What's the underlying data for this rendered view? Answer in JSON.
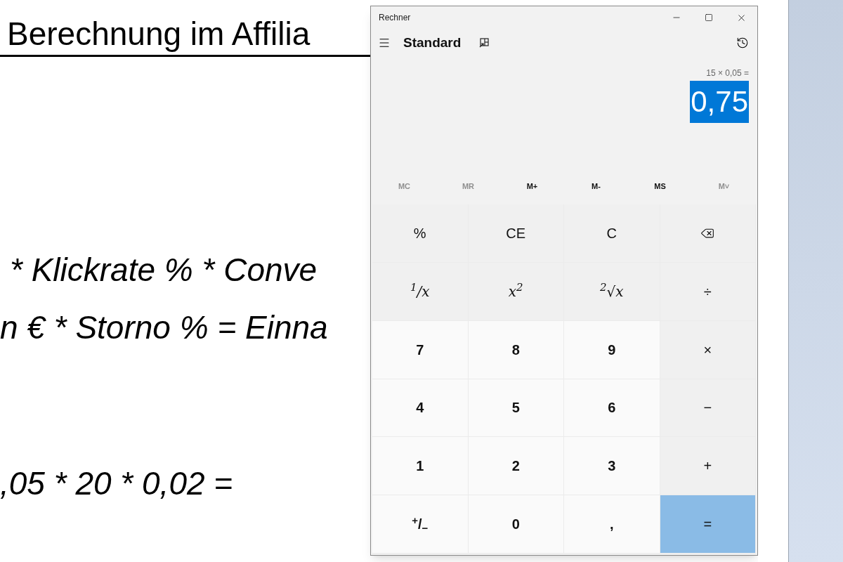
{
  "document": {
    "heading": "Berechnung im Affilia",
    "lines": [
      "* Klickrate % * Conve",
      "n € * Storno % = Einna",
      ",05 * 20 * 0,02 ="
    ]
  },
  "window": {
    "title": "Rechner"
  },
  "header": {
    "mode": "Standard"
  },
  "display": {
    "expression": "15 × 0,05 =",
    "result": "0,75",
    "selected": true
  },
  "memory": [
    {
      "label": "MC",
      "disabled": true
    },
    {
      "label": "MR",
      "disabled": true
    },
    {
      "label": "M+",
      "disabled": false
    },
    {
      "label": "M-",
      "disabled": false
    },
    {
      "label": "MS",
      "disabled": false
    },
    {
      "label": "M˅",
      "disabled": true
    }
  ],
  "keys": [
    {
      "kind": "op",
      "label": "%"
    },
    {
      "kind": "op",
      "label": "CE"
    },
    {
      "kind": "op",
      "label": "C"
    },
    {
      "kind": "backspace"
    },
    {
      "kind": "op",
      "label": "$^{1}$/x"
    },
    {
      "kind": "op",
      "label": "x$^{2}$"
    },
    {
      "kind": "op",
      "label": "$^{2}$√x"
    },
    {
      "kind": "op",
      "label": "÷"
    },
    {
      "kind": "digit",
      "label": "7"
    },
    {
      "kind": "digit",
      "label": "8"
    },
    {
      "kind": "digit",
      "label": "9"
    },
    {
      "kind": "op",
      "label": "×"
    },
    {
      "kind": "digit",
      "label": "4"
    },
    {
      "kind": "digit",
      "label": "5"
    },
    {
      "kind": "digit",
      "label": "6"
    },
    {
      "kind": "op",
      "label": "−"
    },
    {
      "kind": "digit",
      "label": "1"
    },
    {
      "kind": "digit",
      "label": "2"
    },
    {
      "kind": "digit",
      "label": "3"
    },
    {
      "kind": "op",
      "label": "+"
    },
    {
      "kind": "digit",
      "label": "$^{+}$/$_{−}$"
    },
    {
      "kind": "digit",
      "label": "0"
    },
    {
      "kind": "digit",
      "label": ","
    },
    {
      "kind": "equals",
      "label": "="
    }
  ]
}
